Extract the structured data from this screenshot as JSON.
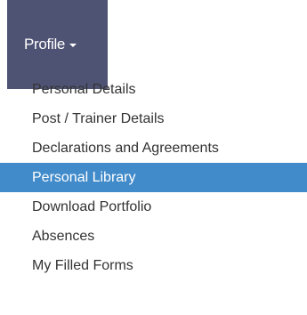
{
  "colors": {
    "toggle_bg": "#4f5373",
    "active_bg": "#428bca",
    "text": "#333333",
    "active_text": "#ffffff"
  },
  "profile": {
    "label": "Profile",
    "icon": "caret-down-icon"
  },
  "menu": {
    "active_index": 3,
    "items": [
      {
        "label": "Personal Details"
      },
      {
        "label": "Post / Trainer Details"
      },
      {
        "label": "Declarations and Agreements"
      },
      {
        "label": "Personal Library"
      },
      {
        "label": "Download Portfolio"
      },
      {
        "label": "Absences"
      },
      {
        "label": "My Filled Forms"
      }
    ]
  }
}
